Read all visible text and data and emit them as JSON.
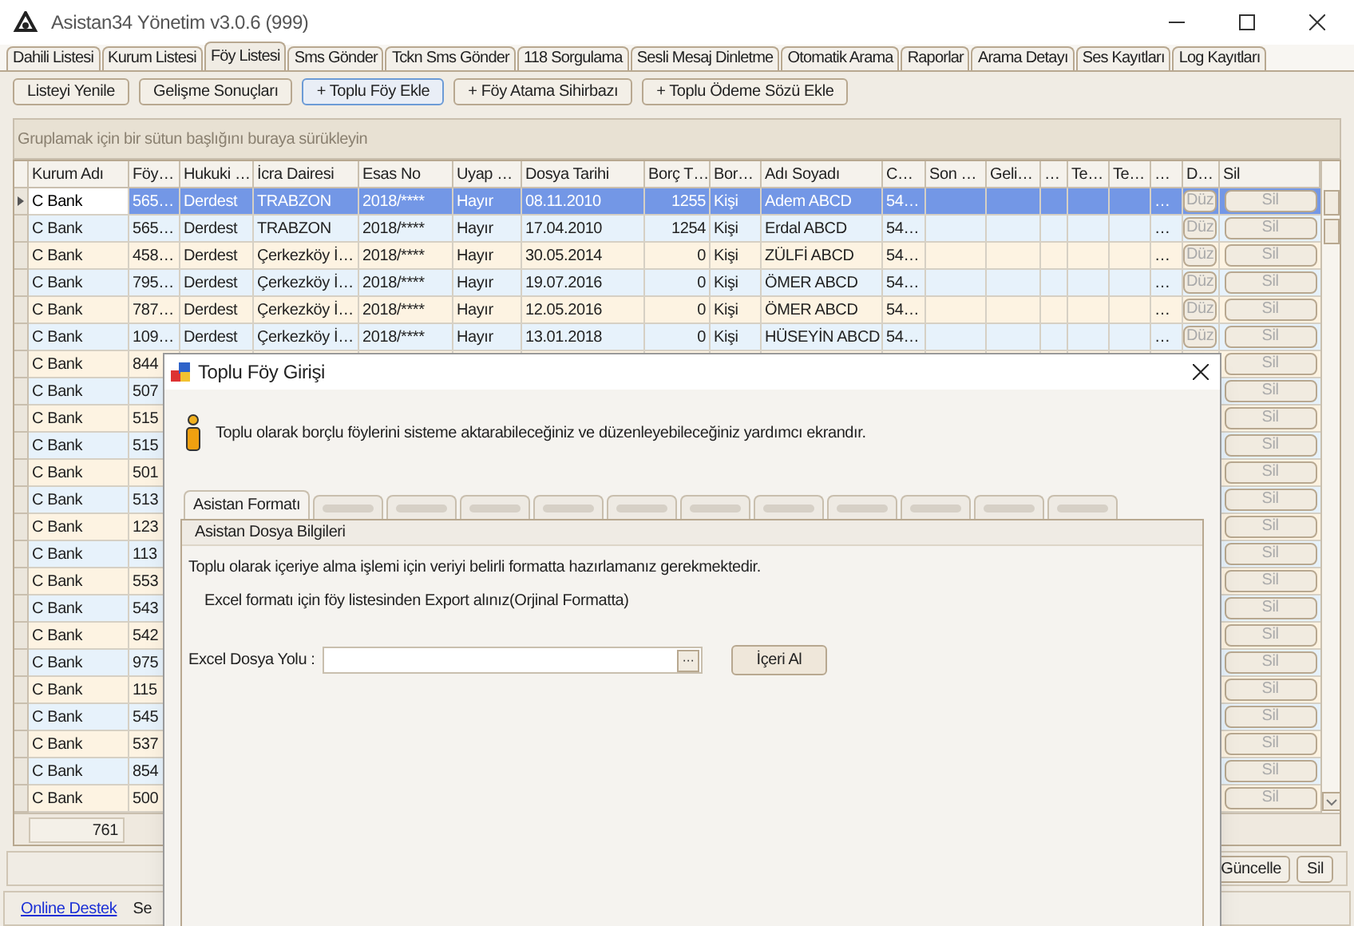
{
  "window": {
    "title": "Asistan34 Yönetim v3.0.6 (999)"
  },
  "tabs": [
    {
      "label": "Dahili Listesi",
      "selected": false
    },
    {
      "label": "Kurum Listesi",
      "selected": false
    },
    {
      "label": "Föy Listesi",
      "selected": true
    },
    {
      "label": "Sms Gönder",
      "selected": false
    },
    {
      "label": "Tckn Sms Gönder",
      "selected": false
    },
    {
      "label": "118 Sorgulama",
      "selected": false
    },
    {
      "label": "Sesli Mesaj Dinletme",
      "selected": false
    },
    {
      "label": "Otomatik Arama",
      "selected": false
    },
    {
      "label": "Raporlar",
      "selected": false
    },
    {
      "label": "Arama Detayı",
      "selected": false
    },
    {
      "label": "Ses Kayıtları",
      "selected": false
    },
    {
      "label": "Log Kayıtları",
      "selected": false
    }
  ],
  "toolbar": [
    {
      "label": "Listeyi Yenile",
      "focused": false
    },
    {
      "label": "Gelişme Sonuçları",
      "focused": false
    },
    {
      "label": "+ Toplu Föy Ekle",
      "focused": true
    },
    {
      "label": "+ Föy Atama Sihirbazı",
      "focused": false
    },
    {
      "label": "+ Toplu Ödeme Sözü Ekle",
      "focused": false
    }
  ],
  "group_panel": {
    "hint": "Gruplamak için bir sütun başlığını buraya sürükleyin"
  },
  "table": {
    "columns": [
      "Kurum Adı",
      "Föy…",
      "Hukuki …",
      "İcra Dairesi",
      "Esas No",
      "Uyap …",
      "Dosya Tarihi",
      "Borç T…",
      "Bor…",
      "Adı Soyadı",
      "C…",
      "Son …",
      "Geli…",
      "…",
      "Te…",
      "Te…",
      "…",
      "D…",
      "Sil"
    ],
    "rows": [
      {
        "selected": true,
        "cells": [
          "C Bank",
          "565…",
          "Derdest",
          "TRABZON",
          "2018/****",
          "Hayır",
          "08.11.2010",
          "1255",
          "Kişi",
          "Adem ABCD",
          "54…",
          "",
          "",
          "",
          "",
          "",
          "…"
        ],
        "edit": "Düz",
        "delete": "Sil"
      },
      {
        "selected": false,
        "cells": [
          "C Bank",
          "565…",
          "Derdest",
          "TRABZON",
          "2018/****",
          "Hayır",
          "17.04.2010",
          "1254",
          "Kişi",
          "Erdal ABCD",
          "54…",
          "",
          "",
          "",
          "",
          "",
          "…"
        ],
        "edit": "Düz",
        "delete": "Sil"
      },
      {
        "selected": false,
        "cells": [
          "C Bank",
          "458…",
          "Derdest",
          "Çerkezköy İ…",
          "2018/****",
          "Hayır",
          "30.05.2014",
          "0",
          "Kişi",
          "ZÜLFİ ABCD",
          "54…",
          "",
          "",
          "",
          "",
          "",
          "…"
        ],
        "edit": "Düz",
        "delete": "Sil"
      },
      {
        "selected": false,
        "cells": [
          "C Bank",
          "795…",
          "Derdest",
          "Çerkezköy İ…",
          "2018/****",
          "Hayır",
          "19.07.2016",
          "0",
          "Kişi",
          "ÖMER ABCD",
          "54…",
          "",
          "",
          "",
          "",
          "",
          "…"
        ],
        "edit": "Düz",
        "delete": "Sil"
      },
      {
        "selected": false,
        "cells": [
          "C Bank",
          "787…",
          "Derdest",
          "Çerkezköy İ…",
          "2018/****",
          "Hayır",
          "12.05.2016",
          "0",
          "Kişi",
          "ÖMER ABCD",
          "54…",
          "",
          "",
          "",
          "",
          "",
          "…"
        ],
        "edit": "Düz",
        "delete": "Sil"
      },
      {
        "selected": false,
        "cells": [
          "C Bank",
          "109…",
          "Derdest",
          "Çerkezköy İ…",
          "2018/****",
          "Hayır",
          "13.01.2018",
          "0",
          "Kişi",
          "HÜSEYİN ABCD",
          "54…",
          "",
          "",
          "",
          "",
          "",
          "…"
        ],
        "edit": "Düz",
        "delete": "Sil"
      },
      {
        "selected": false,
        "cells": [
          "C Bank",
          "844"
        ],
        "delete": "Sil"
      },
      {
        "selected": false,
        "cells": [
          "C Bank",
          "507"
        ],
        "delete": "Sil"
      },
      {
        "selected": false,
        "cells": [
          "C Bank",
          "515"
        ],
        "delete": "Sil"
      },
      {
        "selected": false,
        "cells": [
          "C Bank",
          "515"
        ],
        "delete": "Sil"
      },
      {
        "selected": false,
        "cells": [
          "C Bank",
          "501"
        ],
        "delete": "Sil"
      },
      {
        "selected": false,
        "cells": [
          "C Bank",
          "513"
        ],
        "delete": "Sil"
      },
      {
        "selected": false,
        "cells": [
          "C Bank",
          "123"
        ],
        "delete": "Sil"
      },
      {
        "selected": false,
        "cells": [
          "C Bank",
          "113"
        ],
        "delete": "Sil"
      },
      {
        "selected": false,
        "cells": [
          "C Bank",
          "553"
        ],
        "delete": "Sil"
      },
      {
        "selected": false,
        "cells": [
          "C Bank",
          "543"
        ],
        "delete": "Sil"
      },
      {
        "selected": false,
        "cells": [
          "C Bank",
          "542"
        ],
        "delete": "Sil"
      },
      {
        "selected": false,
        "cells": [
          "C Bank",
          "975"
        ],
        "delete": "Sil"
      },
      {
        "selected": false,
        "cells": [
          "C Bank",
          "115"
        ],
        "delete": "Sil"
      },
      {
        "selected": false,
        "cells": [
          "C Bank",
          "545"
        ],
        "delete": "Sil"
      },
      {
        "selected": false,
        "cells": [
          "C Bank",
          "537"
        ],
        "delete": "Sil"
      },
      {
        "selected": false,
        "cells": [
          "C Bank",
          "854"
        ],
        "delete": "Sil"
      },
      {
        "selected": false,
        "cells": [
          "C Bank",
          "500"
        ],
        "delete": "Sil"
      }
    ],
    "footer_count": "761"
  },
  "actions": [
    "Güncelle",
    "Sil"
  ],
  "status_bar": {
    "link": "Online Destek",
    "text": "Se"
  },
  "dialog": {
    "title": "Toplu Föy Girişi",
    "info": "Toplu olarak borçlu föylerini sisteme aktarabileceğiniz ve düzenleyebileceğiniz yardımcı ekrandır.",
    "tabs": [
      {
        "label": "Asistan Formatı",
        "selected": true
      },
      {
        "selected": false
      },
      {
        "selected": false
      },
      {
        "selected": false
      },
      {
        "selected": false
      },
      {
        "selected": false
      },
      {
        "selected": false
      },
      {
        "selected": false
      },
      {
        "selected": false
      },
      {
        "selected": false
      },
      {
        "selected": false
      },
      {
        "selected": false
      }
    ],
    "group_title": "Asistan Dosya Bilgileri",
    "line_1": "Toplu olarak içeriye alma işlemi için veriyi belirli formatta hazırlamanız gerekmektedir.",
    "line_2": "Excel formatı için föy listesinden Export alınız(Orjinal Formatta)",
    "file_label": "Excel Dosya Yolu :",
    "browse": "···",
    "import_button": "İçeri Al"
  }
}
